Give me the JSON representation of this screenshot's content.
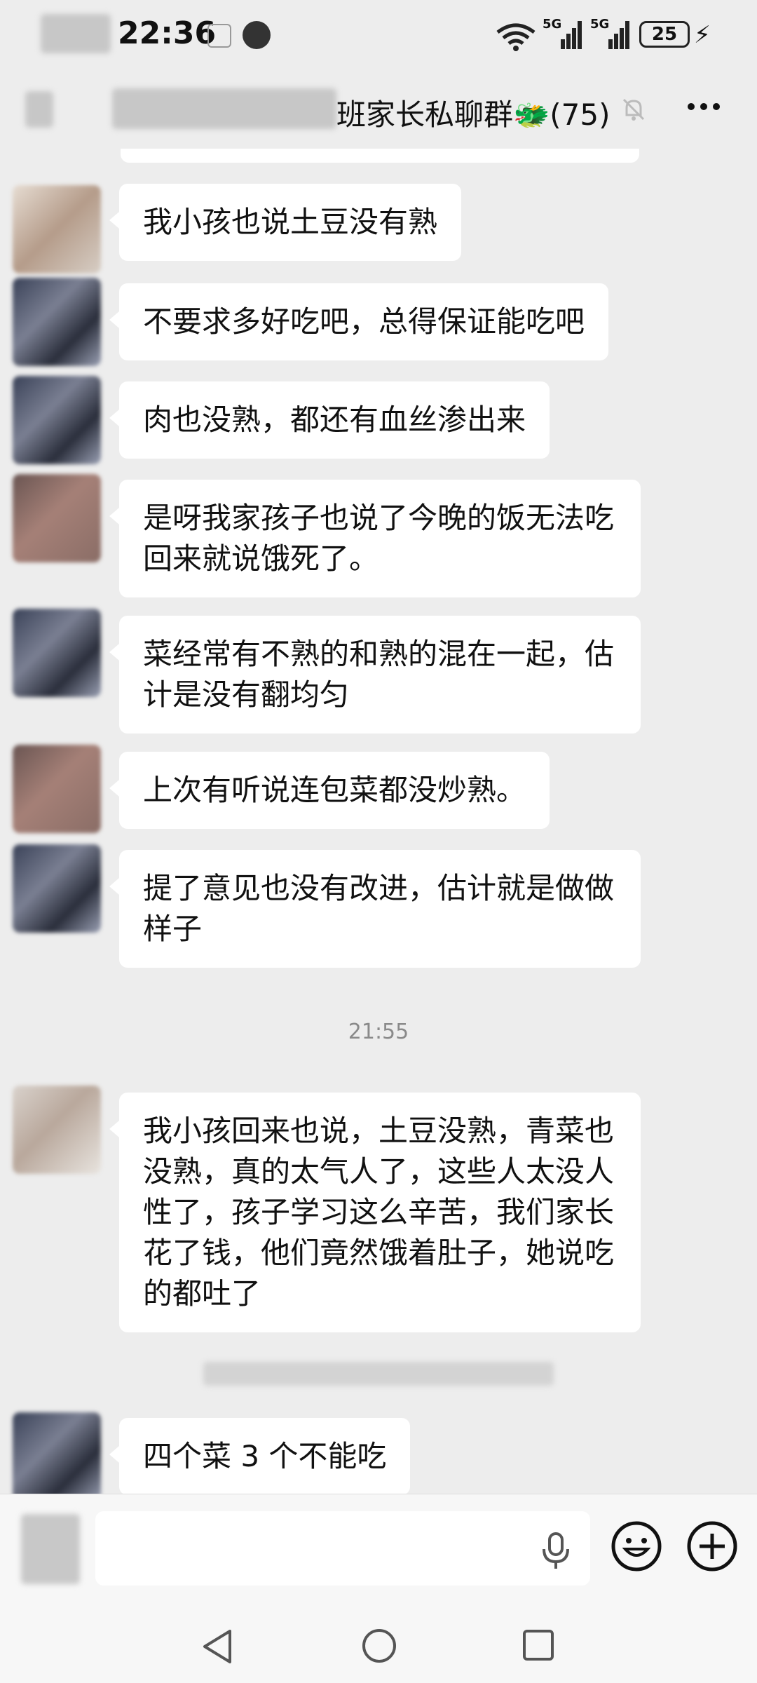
{
  "status_bar": {
    "time": "22:36",
    "signal1_label": "5G",
    "signal2_label": "5G",
    "battery": "25"
  },
  "header": {
    "title": "班家长私聊群🐲(75)"
  },
  "messages": [
    {
      "text": "我小孩也说土豆没有熟"
    },
    {
      "text": "不要求多好吃吧，总得保证能吃吧"
    },
    {
      "text": "肉也没熟，都还有血丝渗出来"
    },
    {
      "text": "是呀我家孩子也说了今晚的饭无法吃回来就说饿死了。"
    },
    {
      "text": "菜经常有不熟的和熟的混在一起，估计是没有翻均匀"
    },
    {
      "text": "上次有听说连包菜都没炒熟。"
    },
    {
      "text": "提了意见也没有改进，估计就是做做样子"
    },
    {
      "text": "我小孩回来也说，土豆没熟，青菜也没熟，真的太气人了，这些人太没人性了，孩子学习这么辛苦，我们家长花了钱，他们竟然饿着肚子，她说吃的都吐了"
    },
    {
      "text": "四个菜 3 个不能吃"
    }
  ],
  "timestamp": "21:55",
  "icons": {
    "mute": "mute-bell-icon",
    "more": "more-icon",
    "mic": "microphone-icon",
    "emoji": "emoji-icon",
    "plus": "plus-icon",
    "nav_back": "triangle-back-icon",
    "nav_home": "circle-home-icon",
    "nav_recent": "square-recent-icon"
  }
}
